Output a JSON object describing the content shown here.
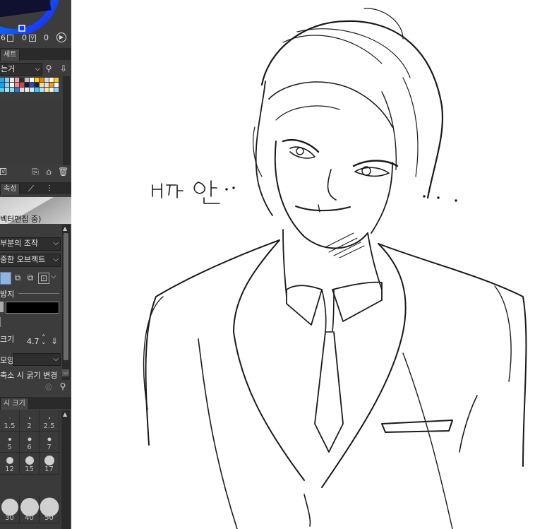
{
  "color_wheel": {
    "values": [
      "6",
      "0",
      "0"
    ],
    "value_icons": [
      "list-icon",
      "v-icon"
    ],
    "play_icon": "play-circle-icon"
  },
  "color_set": {
    "tab_label": "세트",
    "dropdown_value": "는거",
    "swatch_colors": [
      "#2ea7e0",
      "#ffffff",
      "#7fd0ff",
      "#f2a0b0",
      "#e04040",
      "#1a1a1a",
      "#ffd200",
      "#f08000",
      "#00aaff",
      "#8ecfff",
      "#e0e0e0",
      "#ff80a0",
      "#c0c0c0",
      "#4040c0",
      "#ffe080",
      "#ff9900",
      "#4fd0e0",
      "#a0e0ff",
      "#ffffff",
      "#80e0ff",
      "#2080c0",
      "#c0f0ff",
      "#ffe0a0",
      "#f0f0f0"
    ]
  },
  "layer_footer": {
    "icons": [
      "new-layer-icon",
      "fill-icon",
      "trash-icon"
    ]
  },
  "tool_property": {
    "tab_label": "속성",
    "subtool_title": "벡터편집 중)",
    "options": [
      {
        "label": "부분의 조작",
        "kind": "dropdown"
      },
      {
        "label": "중한 오브젝트",
        "kind": "dropdown"
      }
    ],
    "section_label": "방지",
    "brush_size_label": "크기",
    "brush_size_value": "4.7",
    "shape_label": "모양",
    "zoom_change_label": "축소 시 굵기 변경",
    "main_color": "#000000"
  },
  "brush_size": {
    "tab_label": "시 크기",
    "sizes": [
      "1.5",
      "2",
      "2.5",
      "5",
      "6",
      "7",
      "12",
      "15",
      "17",
      "30",
      "40",
      "50"
    ]
  }
}
